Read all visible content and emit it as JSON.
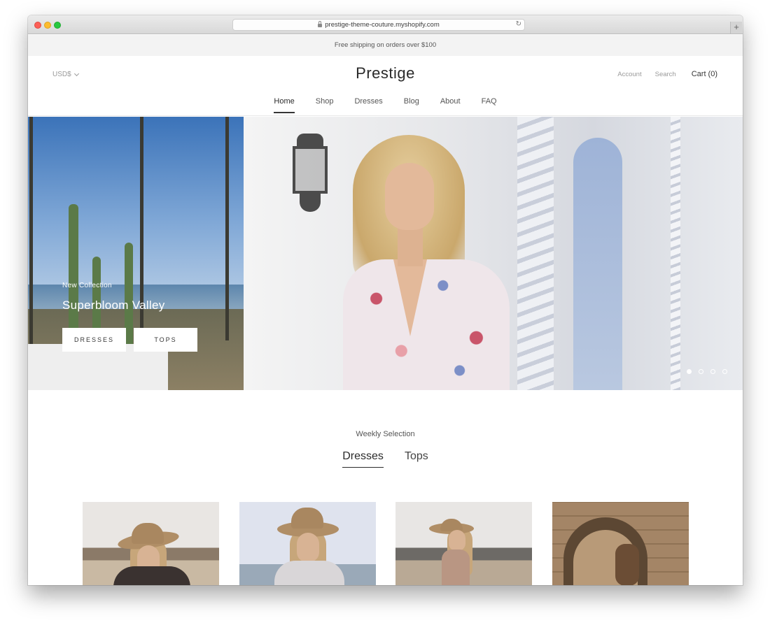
{
  "browser": {
    "url": "prestige-theme-couture.myshopify.com",
    "new_tab_label": "+"
  },
  "announcement": {
    "text": "Free shipping on orders over $100"
  },
  "header": {
    "currency": "USD$",
    "logo": "Prestige",
    "account": "Account",
    "search": "Search",
    "cart": "Cart (0)"
  },
  "nav": {
    "items": [
      {
        "label": "Home",
        "active": true
      },
      {
        "label": "Shop"
      },
      {
        "label": "Dresses"
      },
      {
        "label": "Blog"
      },
      {
        "label": "About"
      },
      {
        "label": "FAQ"
      }
    ]
  },
  "hero": {
    "eyebrow": "New Collection",
    "title": "Superbloom Valley",
    "buttons": [
      "DRESSES",
      "TOPS"
    ],
    "slides_total": 4,
    "active_slide": 1
  },
  "weekly": {
    "subheading": "Weekly Selection",
    "tabs": [
      {
        "label": "Dresses",
        "active": true
      },
      {
        "label": "Tops"
      }
    ]
  },
  "colors": {
    "text": "#363636",
    "announcement_bg": "#f3f3f3",
    "button_bg": "#ffffff"
  },
  "icons": [
    "lock-icon",
    "reload-icon",
    "chevron-down-icon"
  ]
}
